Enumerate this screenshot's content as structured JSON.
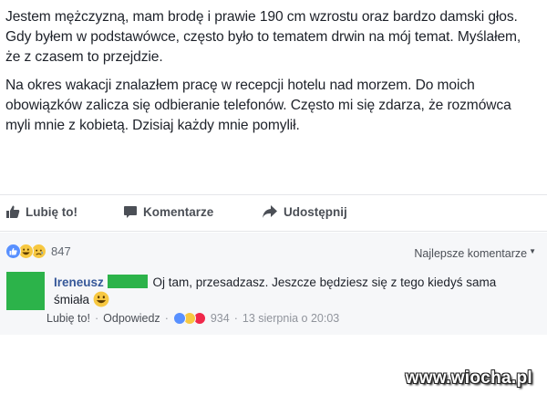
{
  "post": {
    "paragraphs": [
      "Jestem mężczyzną, mam brodę i prawie 190 cm wzrostu oraz bardzo damski głos. Gdy byłem w podstawówce, często było to tematem drwin na mój temat. Myślałem, że z czasem to przejdzie.",
      "Na okres wakacji znalazłem pracę w recepcji hotelu nad morzem. Do moich obowiązków zalicza się odbieranie telefonów. Często mi się zdarza, że rozmówca myli mnie z kobietą. Dzisiaj każdy mnie pomylił."
    ]
  },
  "actions": {
    "like_label": "Lubię to!",
    "comment_label": "Komentarze",
    "share_label": "Udostępnij"
  },
  "reactions": {
    "icons": [
      "like-reaction",
      "haha-reaction",
      "sad-reaction"
    ],
    "count": "847"
  },
  "comments_section": {
    "sort_label": "Najlepsze komentarze"
  },
  "comment": {
    "author": "Ireneusz",
    "text": "Oj tam, przesadzasz. Jeszcze będziesz się z tego kiedyś sama śmiała",
    "like_link": "Lubię to!",
    "reply_link": "Odpowiedz",
    "reactions": [
      "like-reaction",
      "haha-reaction",
      "love-reaction"
    ],
    "reaction_count": "934",
    "timestamp": "13 sierpnia o 20:03"
  },
  "watermark": "www.wiocha.pl",
  "colors": {
    "facebook_blue": "#365899",
    "like_blue": "#5890ff",
    "haha_yellow": "#f7c841",
    "love_red": "#f0284a",
    "avatar_green": "#2cb34a"
  }
}
